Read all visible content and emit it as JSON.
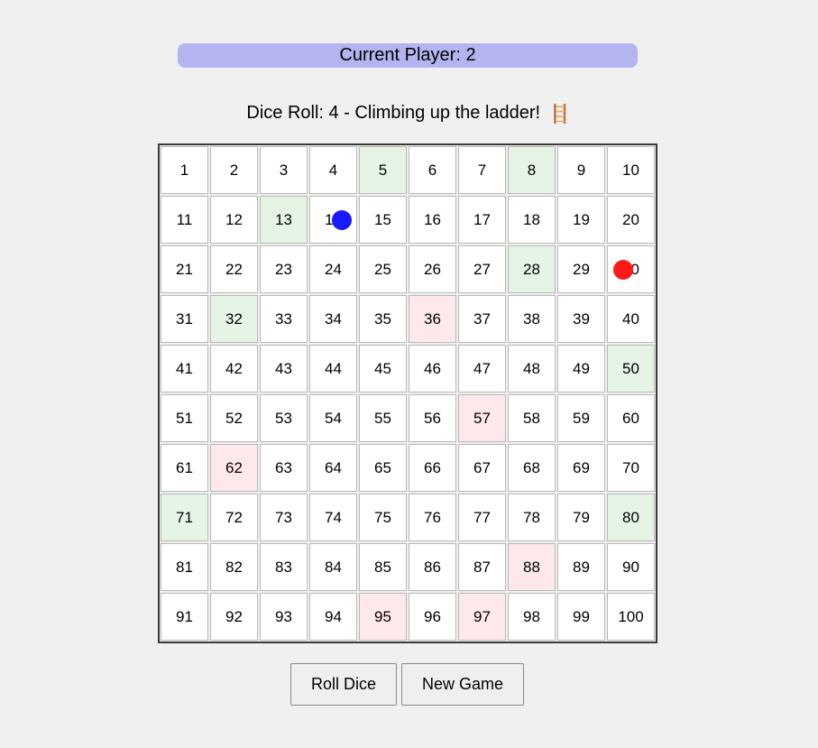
{
  "status": {
    "current_player_text": "Current Player: 2",
    "dice_message": "Dice Roll: 4 - Climbing up the ladder!",
    "dice_emoji": "🪜"
  },
  "board": {
    "size": 100,
    "ladder_cells": [
      5,
      8,
      13,
      28,
      32,
      50,
      71,
      80
    ],
    "snake_cells": [
      36,
      57,
      62,
      88,
      95,
      97
    ],
    "ladder_color": "#e6f4e6",
    "snake_color": "#fde9ec"
  },
  "players": [
    {
      "id": 1,
      "position": 14,
      "color": "#1a1aff"
    },
    {
      "id": 2,
      "position": 30,
      "color": "#ff1a1a"
    }
  ],
  "controls": {
    "roll_label": "Roll Dice",
    "new_game_label": "New Game"
  }
}
